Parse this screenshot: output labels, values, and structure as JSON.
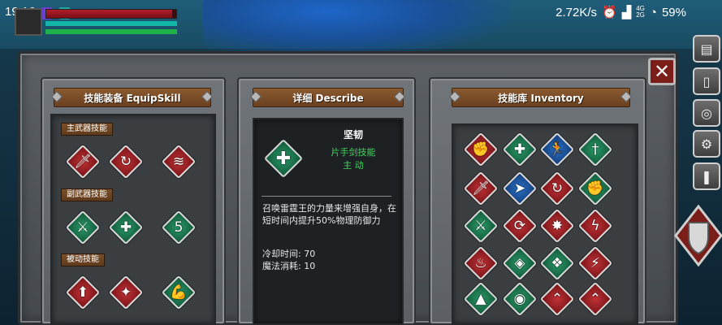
{
  "status_bar": {
    "time": "19:16",
    "net_speed": "2.72K/s",
    "network": "4G\n2G",
    "battery": "59%"
  },
  "hud": {
    "hp_fraction": 0.97,
    "mp_fraction": 1.0,
    "xp_fraction": 1.0
  },
  "panels": {
    "equip_title": "技能装备 EquipSkill",
    "describe_title": "详细 Describe",
    "inventory_title": "技能库 Inventory"
  },
  "equip": {
    "sections": [
      {
        "label": "主武器技能",
        "skills": [
          {
            "icon": "dagger-strike-icon",
            "glyph": "🗡",
            "color": "red"
          },
          {
            "icon": "whirlwind-icon",
            "glyph": "↻",
            "color": "red"
          },
          {
            "icon": "claw-slash-icon",
            "glyph": "≋",
            "color": "red"
          }
        ]
      },
      {
        "label": "副武器技能",
        "skills": [
          {
            "icon": "axe-icon",
            "glyph": "⚔",
            "color": "green"
          },
          {
            "icon": "cross-shield-icon",
            "glyph": "✚",
            "color": "green"
          },
          {
            "icon": "numbered-shield-icon",
            "glyph": "5",
            "color": "green"
          }
        ]
      },
      {
        "label": "被动技能",
        "skills": [
          {
            "icon": "sword-up-icon",
            "glyph": "⬆",
            "color": "red"
          },
          {
            "icon": "star-sword-icon",
            "glyph": "✦",
            "color": "red"
          },
          {
            "icon": "flex-arm-icon",
            "glyph": "💪",
            "color": "green"
          }
        ]
      }
    ]
  },
  "describe": {
    "name": "坚韧",
    "type": "片手剑技能",
    "sub": "主 动",
    "text": "召唤雷霆王的力量来增强自身，在短时间内提升50%物理防御力",
    "cooldown": "冷却时间: 70",
    "mana": "魔法消耗: 10"
  },
  "inventory": {
    "skills": [
      {
        "icon": "gauntlet-icon",
        "glyph": "✊",
        "color": "red"
      },
      {
        "icon": "cross-shield-icon",
        "glyph": "✚",
        "color": "green"
      },
      {
        "icon": "runner-icon",
        "glyph": "🏃",
        "color": "blue"
      },
      {
        "icon": "sword-green-icon",
        "glyph": "†",
        "color": "green"
      },
      {
        "icon": "dagger-strike-icon",
        "glyph": "🗡",
        "color": "red"
      },
      {
        "icon": "dash-icon",
        "glyph": "➤",
        "color": "blue"
      },
      {
        "icon": "whirlwind-icon",
        "glyph": "↻",
        "color": "red"
      },
      {
        "icon": "fist-icon",
        "glyph": "✊",
        "color": "green"
      },
      {
        "icon": "axe-icon",
        "glyph": "⚔",
        "color": "green"
      },
      {
        "icon": "spiral-strike-icon",
        "glyph": "⟳",
        "color": "red"
      },
      {
        "icon": "burst-icon",
        "glyph": "✸",
        "color": "red"
      },
      {
        "icon": "lightning-icon",
        "glyph": "ϟ",
        "color": "red"
      },
      {
        "icon": "flame-icon",
        "glyph": "♨",
        "color": "red"
      },
      {
        "icon": "gem-helmet-icon",
        "glyph": "◈",
        "color": "green"
      },
      {
        "icon": "beast-icon",
        "glyph": "❖",
        "color": "green"
      },
      {
        "icon": "slash-icon",
        "glyph": "⚡",
        "color": "red"
      },
      {
        "icon": "cart-icon",
        "glyph": "▲",
        "color": "green"
      },
      {
        "icon": "shell-icon",
        "glyph": "◉",
        "color": "green"
      },
      {
        "icon": "chevron-up-icon",
        "glyph": "⌃",
        "color": "red"
      },
      {
        "icon": "double-chevron-icon",
        "glyph": "⌃",
        "color": "red"
      }
    ]
  },
  "side_buttons": [
    {
      "icon": "bag-icon",
      "glyph": "▤"
    },
    {
      "icon": "door-icon",
      "glyph": "▯"
    },
    {
      "icon": "emblem-icon",
      "glyph": "◎"
    },
    {
      "icon": "gear-icon",
      "glyph": "⚙"
    },
    {
      "icon": "scroll-icon",
      "glyph": "❚"
    }
  ],
  "colors": {
    "red": "#c03236",
    "green": "#2a9a6a",
    "blue": "#2a72c8",
    "skill_type_text": "#3ed65a"
  }
}
